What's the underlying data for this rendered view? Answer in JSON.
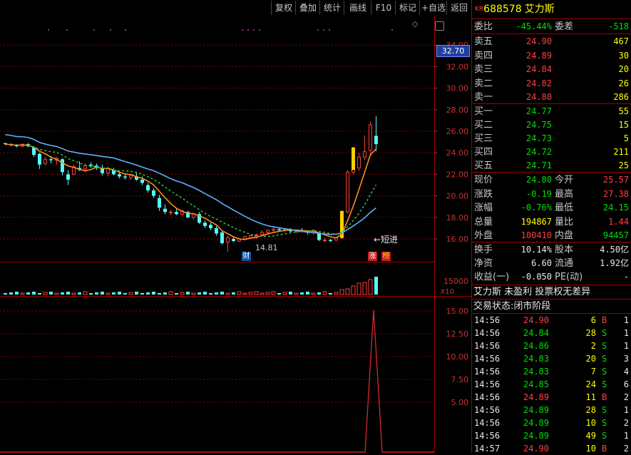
{
  "toolbar": {
    "buttons": [
      "复权",
      "叠加",
      "统计",
      "画线",
      "F10",
      "标记",
      "+自选",
      "返回"
    ]
  },
  "chart": {
    "price_axis": [
      "34.00",
      "32.00",
      "30.00",
      "28.00",
      "26.00",
      "24.00",
      "22.00",
      "20.00",
      "18.00",
      "16.00"
    ],
    "current_price_tag": "32.70",
    "low_label": "14.81",
    "short_label": "←短进",
    "event_tags": [
      "财",
      "涨",
      "榜"
    ],
    "volume_axis": [
      "15000",
      "X10"
    ],
    "indicator_axis": [
      "15.00",
      "12.50",
      "10.00",
      "7.50",
      "5.00"
    ]
  },
  "chart_data": {
    "type": "candlestick",
    "candles": [
      [
        24.9,
        24.9,
        24.7,
        24.8
      ],
      [
        24.8,
        24.9,
        24.6,
        24.7
      ],
      [
        24.7,
        24.8,
        24.5,
        24.6
      ],
      [
        24.6,
        24.8,
        24.5,
        24.8
      ],
      [
        24.8,
        24.9,
        24.5,
        24.6
      ],
      [
        24.5,
        24.6,
        23.6,
        23.8
      ],
      [
        23.9,
        24.0,
        22.5,
        22.9
      ],
      [
        23.0,
        23.6,
        22.8,
        23.4
      ],
      [
        23.4,
        23.7,
        23.0,
        23.3
      ],
      [
        23.3,
        23.6,
        22.9,
        23.5
      ],
      [
        23.4,
        23.5,
        21.9,
        22.2
      ],
      [
        22.0,
        22.4,
        21.0,
        21.5
      ],
      [
        22.0,
        22.9,
        21.9,
        22.7
      ],
      [
        22.6,
        23.2,
        22.3,
        22.4
      ],
      [
        22.5,
        23.0,
        22.2,
        22.8
      ],
      [
        22.9,
        23.1,
        22.6,
        22.8
      ],
      [
        22.8,
        23.0,
        22.4,
        22.6
      ],
      [
        22.6,
        22.9,
        21.9,
        22.1
      ],
      [
        22.1,
        22.7,
        21.8,
        22.5
      ],
      [
        22.4,
        22.6,
        21.9,
        22.0
      ],
      [
        22.0,
        22.2,
        21.6,
        21.8
      ],
      [
        21.8,
        22.0,
        21.5,
        21.7
      ],
      [
        21.7,
        22.0,
        21.5,
        21.9
      ],
      [
        21.8,
        22.2,
        21.4,
        21.5
      ],
      [
        21.5,
        21.8,
        21.0,
        21.2
      ],
      [
        21.0,
        21.2,
        20.3,
        20.5
      ],
      [
        20.5,
        20.7,
        19.8,
        20.0
      ],
      [
        19.8,
        20.1,
        18.6,
        18.9
      ],
      [
        18.8,
        19.2,
        18.3,
        18.5
      ],
      [
        18.5,
        18.7,
        18.2,
        18.5
      ],
      [
        18.5,
        18.8,
        18.2,
        18.3
      ],
      [
        18.3,
        18.7,
        18.1,
        18.6
      ],
      [
        18.5,
        18.6,
        17.9,
        18.0
      ],
      [
        18.0,
        18.4,
        17.8,
        18.3
      ],
      [
        18.3,
        18.5,
        17.4,
        17.5
      ],
      [
        17.5,
        17.7,
        17.0,
        17.2
      ],
      [
        17.3,
        17.5,
        16.8,
        17.0
      ],
      [
        17.0,
        17.2,
        16.3,
        16.5
      ],
      [
        16.6,
        16.7,
        15.5,
        15.6
      ],
      [
        15.7,
        16.3,
        14.81,
        16.1
      ],
      [
        16.0,
        16.2,
        15.7,
        15.8
      ],
      [
        15.8,
        16.1,
        15.7,
        16.0
      ],
      [
        16.0,
        16.3,
        15.9,
        16.2
      ],
      [
        16.1,
        16.4,
        16.0,
        16.3
      ],
      [
        16.2,
        16.5,
        16.0,
        16.4
      ],
      [
        16.4,
        16.8,
        16.3,
        16.6
      ],
      [
        16.6,
        16.9,
        16.4,
        16.8
      ],
      [
        16.8,
        17.1,
        16.6,
        16.9
      ],
      [
        16.9,
        17.0,
        16.7,
        16.8
      ],
      [
        16.8,
        17.0,
        16.6,
        16.9
      ],
      [
        16.9,
        17.0,
        16.6,
        16.7
      ],
      [
        16.7,
        16.9,
        16.5,
        16.8
      ],
      [
        16.8,
        17.0,
        16.6,
        16.7
      ],
      [
        16.7,
        16.8,
        16.4,
        16.6
      ],
      [
        16.6,
        16.9,
        16.4,
        16.8
      ],
      [
        16.5,
        16.6,
        15.8,
        15.9
      ],
      [
        15.9,
        16.1,
        15.7,
        15.9
      ],
      [
        15.9,
        16.0,
        15.7,
        15.8
      ],
      [
        15.9,
        16.2,
        15.8,
        16.1
      ],
      [
        16.1,
        18.6,
        16.0,
        18.5
      ],
      [
        18.5,
        22.4,
        18.4,
        22.2
      ],
      [
        22.2,
        24.5,
        22.0,
        22.6
      ],
      [
        22.6,
        24.0,
        22.3,
        23.6
      ],
      [
        23.6,
        25.6,
        23.3,
        24.1
      ],
      [
        24.2,
        26.9,
        23.9,
        26.6
      ],
      [
        25.57,
        27.38,
        24.15,
        24.8
      ]
    ]
  },
  "quote": {
    "market_tag": "KR",
    "code": "688578",
    "name": "艾力斯",
    "weibi_label": "委比",
    "weibi_value": "-45.44%",
    "weicha_label": "委差",
    "weicha_value": "-518",
    "asks": [
      {
        "label": "卖五",
        "price": "24.90",
        "vol": "467"
      },
      {
        "label": "卖四",
        "price": "24.89",
        "vol": "30"
      },
      {
        "label": "卖三",
        "price": "24.84",
        "vol": "20"
      },
      {
        "label": "卖二",
        "price": "24.82",
        "vol": "26"
      },
      {
        "label": "卖一",
        "price": "24.80",
        "vol": "286"
      }
    ],
    "bids": [
      {
        "label": "买一",
        "price": "24.77",
        "vol": "55"
      },
      {
        "label": "买二",
        "price": "24.75",
        "vol": "15"
      },
      {
        "label": "买三",
        "price": "24.73",
        "vol": "5"
      },
      {
        "label": "买四",
        "price": "24.72",
        "vol": "211"
      },
      {
        "label": "买五",
        "price": "24.71",
        "vol": "25"
      }
    ],
    "stats": [
      {
        "l1": "现价",
        "v1": "24.80",
        "c1": "green",
        "l2": "今开",
        "v2": "25.57",
        "c2": "red"
      },
      {
        "l1": "涨跌",
        "v1": "-0.19",
        "c1": "green",
        "l2": "最高",
        "v2": "27.38",
        "c2": "red"
      },
      {
        "l1": "涨幅",
        "v1": "-0.76%",
        "c1": "green",
        "l2": "最低",
        "v2": "24.15",
        "c2": "green"
      },
      {
        "l1": "总量",
        "v1": "194867",
        "c1": "yellow",
        "l2": "量比",
        "v2": "1.44",
        "c2": "red"
      },
      {
        "l1": "外盘",
        "v1": "100410",
        "c1": "red",
        "l2": "内盘",
        "v2": "94457",
        "c2": "green"
      }
    ],
    "stats2": [
      {
        "l1": "换手",
        "v1": "10.14%",
        "l2": "股本",
        "v2": "4.50亿"
      },
      {
        "l1": "净资",
        "v1": "6.60",
        "l2": "流通",
        "v2": "1.92亿"
      },
      {
        "l1": "收益(一)",
        "v1": "-0.050",
        "l2": "PE(动)",
        "v2": "-"
      }
    ],
    "notice": "艾力斯 未盈利 投票权无差异",
    "trade_status": "交易状态:闭市阶段"
  },
  "ticks": [
    {
      "time": "14:56",
      "price": "24.90",
      "vol": "6",
      "side": "B",
      "n": "1"
    },
    {
      "time": "14:56",
      "price": "24.84",
      "vol": "28",
      "side": "S",
      "n": "1"
    },
    {
      "time": "14:56",
      "price": "24.86",
      "vol": "2",
      "side": "S",
      "n": "1"
    },
    {
      "time": "14:56",
      "price": "24.83",
      "vol": "20",
      "side": "S",
      "n": "3"
    },
    {
      "time": "14:56",
      "price": "24.83",
      "vol": "7",
      "side": "S",
      "n": "4"
    },
    {
      "time": "14:56",
      "price": "24.85",
      "vol": "24",
      "side": "S",
      "n": "6"
    },
    {
      "time": "14:56",
      "price": "24.89",
      "vol": "11",
      "side": "B",
      "n": "2"
    },
    {
      "time": "14:56",
      "price": "24.89",
      "vol": "28",
      "side": "S",
      "n": "1"
    },
    {
      "time": "14:56",
      "price": "24.89",
      "vol": "10",
      "side": "S",
      "n": "2"
    },
    {
      "time": "14:56",
      "price": "24.89",
      "vol": "49",
      "side": "S",
      "n": "1"
    },
    {
      "time": "14:57",
      "price": "24.90",
      "vol": "10",
      "side": "B",
      "n": "2"
    }
  ],
  "colors": {
    "up": "#ff3c3c",
    "down": "#54fcfc",
    "grid": "#8b0000",
    "ma1": "#ff8c20",
    "ma2": "#60b0ff",
    "ma3": "#20c040"
  }
}
